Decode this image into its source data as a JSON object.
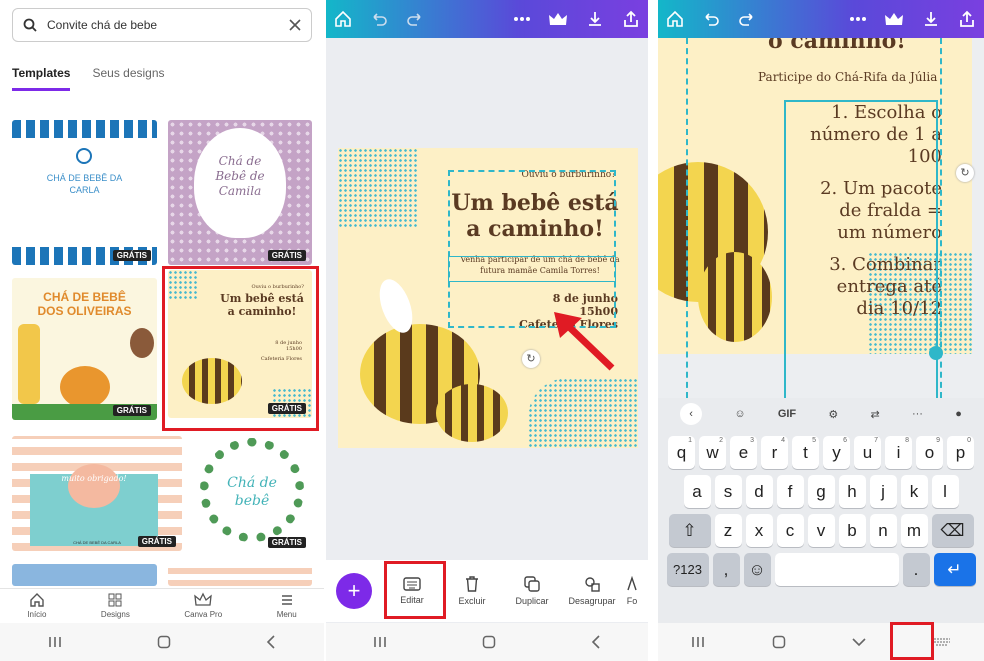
{
  "panel1": {
    "search": {
      "value": "Convite chá de bebe"
    },
    "tabs": [
      {
        "label": "Templates"
      },
      {
        "label": "Seus designs"
      }
    ],
    "cards": [
      {
        "title": "CHÁ DE BEBÊ DA CARLA",
        "badge": "GRÁTIS"
      },
      {
        "title": "Chá de Bebê de Camila",
        "badge": "GRÁTIS"
      },
      {
        "title": "CHÁ DE BEBÊ DOS OLIVEIRAS",
        "badge": "GRÁTIS"
      },
      {
        "title": "Um bebê está a caminho!",
        "subtitle": "Ouviu o burburinho?",
        "date": "8 de junho 15h00",
        "place": "Cafeteria Flores",
        "badge": "GRÁTIS"
      },
      {
        "title": "muito obrigado!",
        "footer": "CHÁ DE BEBÊ DA CARLA",
        "badge": "GRÁTIS"
      },
      {
        "title": "Chá de bebê",
        "badge": "GRÁTIS"
      }
    ],
    "nav": [
      {
        "label": "Início",
        "icon": "home-icon"
      },
      {
        "label": "Designs",
        "icon": "grid-icon"
      },
      {
        "label": "Canva Pro",
        "icon": "crown-icon"
      },
      {
        "label": "Menu",
        "icon": "menu-icon"
      }
    ]
  },
  "panel2": {
    "design": {
      "kicker": "Ouviu o burburinho?",
      "title_line1": "Um bebê está",
      "title_line2": "a caminho!",
      "body": "Venha participar de um chá de bebê da futura mamãe Camila Torres!",
      "date_line1": "8 de junho",
      "date_line2": "15h00",
      "place": "Cafeteria Flores"
    },
    "toolbar": [
      {
        "label": "Editar",
        "icon": "keyboard-icon"
      },
      {
        "label": "Excluir",
        "icon": "trash-icon"
      },
      {
        "label": "Duplicar",
        "icon": "duplicate-icon"
      },
      {
        "label": "Desagrupar",
        "icon": "ungroup-icon"
      },
      {
        "label": "Fo",
        "icon": "font-icon"
      }
    ]
  },
  "panel3": {
    "design": {
      "header": "o caminho!",
      "subtitle": "Participe do Chá-Rifa da Júlia",
      "item1_line1": "1. Escolha o",
      "item1_line2": "número de 1 a",
      "item1_line3": "100",
      "item2_line1": "2. Um pacote",
      "item2_line2": "de fralda =",
      "item2_line3": "um número",
      "item3_line1": "3. Combinar",
      "item3_line2": "entrega até",
      "item3_line3": "dia 10/12"
    },
    "keyboard": {
      "toolbar": [
        "GIF"
      ],
      "row1": [
        "q",
        "w",
        "e",
        "r",
        "t",
        "y",
        "u",
        "i",
        "o",
        "p"
      ],
      "row1_nums": [
        "1",
        "2",
        "3",
        "4",
        "5",
        "6",
        "7",
        "8",
        "9",
        "0"
      ],
      "row2": [
        "a",
        "s",
        "d",
        "f",
        "g",
        "h",
        "j",
        "k",
        "l"
      ],
      "row3": [
        "z",
        "x",
        "c",
        "v",
        "b",
        "n",
        "m"
      ],
      "sym": "?123",
      "comma": ",",
      "period": "."
    }
  },
  "colors": {
    "accent": "#7d2ae8",
    "highlight": "#e01b24",
    "selection": "#2fb7c9"
  }
}
